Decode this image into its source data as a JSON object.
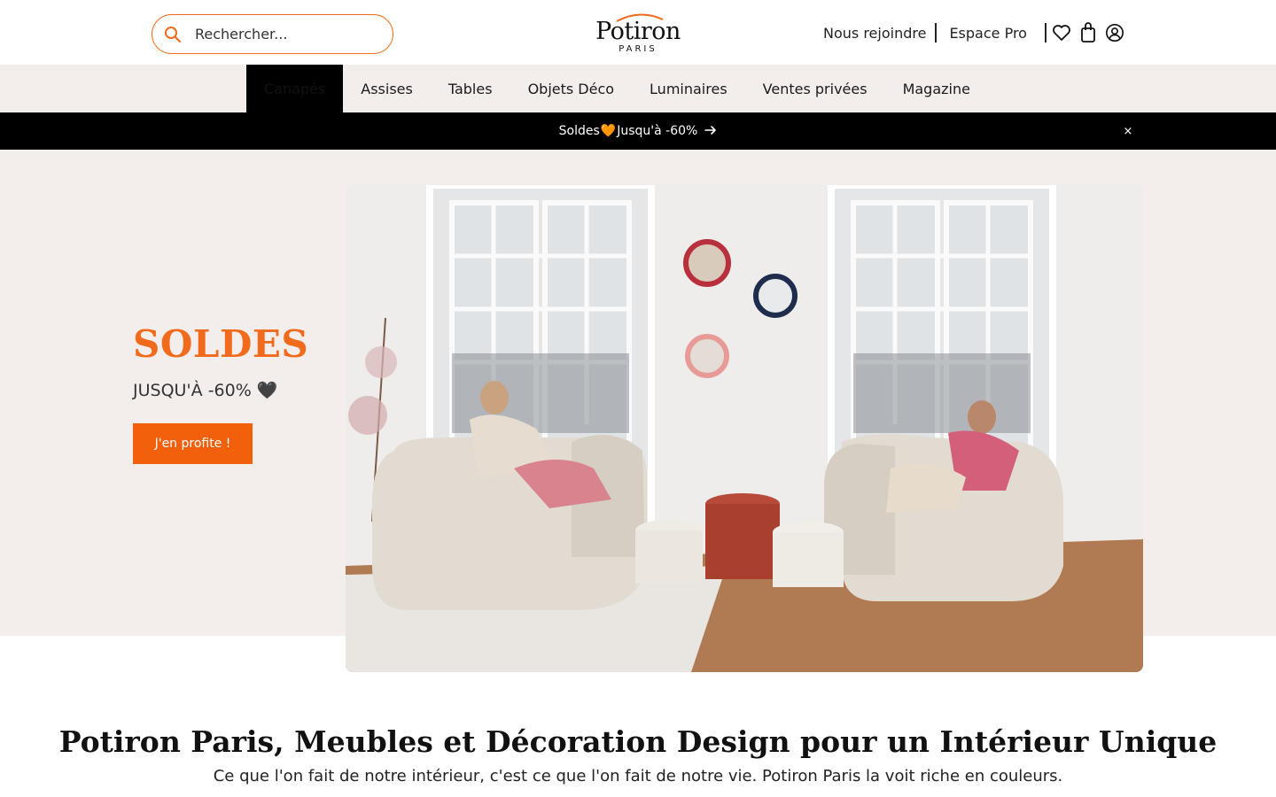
{
  "search": {
    "placeholder": "Rechercher..."
  },
  "logo": {
    "name": "Potiron",
    "city": "PARIS"
  },
  "header_links": {
    "join": "Nous rejoindre",
    "pro": "Espace Pro"
  },
  "header_icons": [
    "heart-icon",
    "bag-icon",
    "account-icon"
  ],
  "nav": {
    "items": [
      {
        "label": "Canapés",
        "active": true
      },
      {
        "label": "Assises"
      },
      {
        "label": "Tables"
      },
      {
        "label": "Objets Déco"
      },
      {
        "label": "Luminaires"
      },
      {
        "label": "Ventes privées"
      },
      {
        "label": "Magazine"
      }
    ]
  },
  "promo": {
    "text_before": "Soldes",
    "heart": "🧡",
    "text_after": "Jusqu'à -60%",
    "close": "×"
  },
  "hero": {
    "title": "SOLDES",
    "subtitle": "JUSQU'À -60% 🖤",
    "cta": "J'en profite !"
  },
  "main": {
    "heading": "Potiron Paris, Meubles et Décoration Design pour un Intérieur Unique",
    "lead": "Ce que l'on fait de notre intérieur, c'est ce que l'on fait de notre vie. Potiron Paris la voit riche en couleurs."
  },
  "colors": {
    "accent": "#f26a1b",
    "beige": "#f3eeeb",
    "black": "#000000"
  }
}
